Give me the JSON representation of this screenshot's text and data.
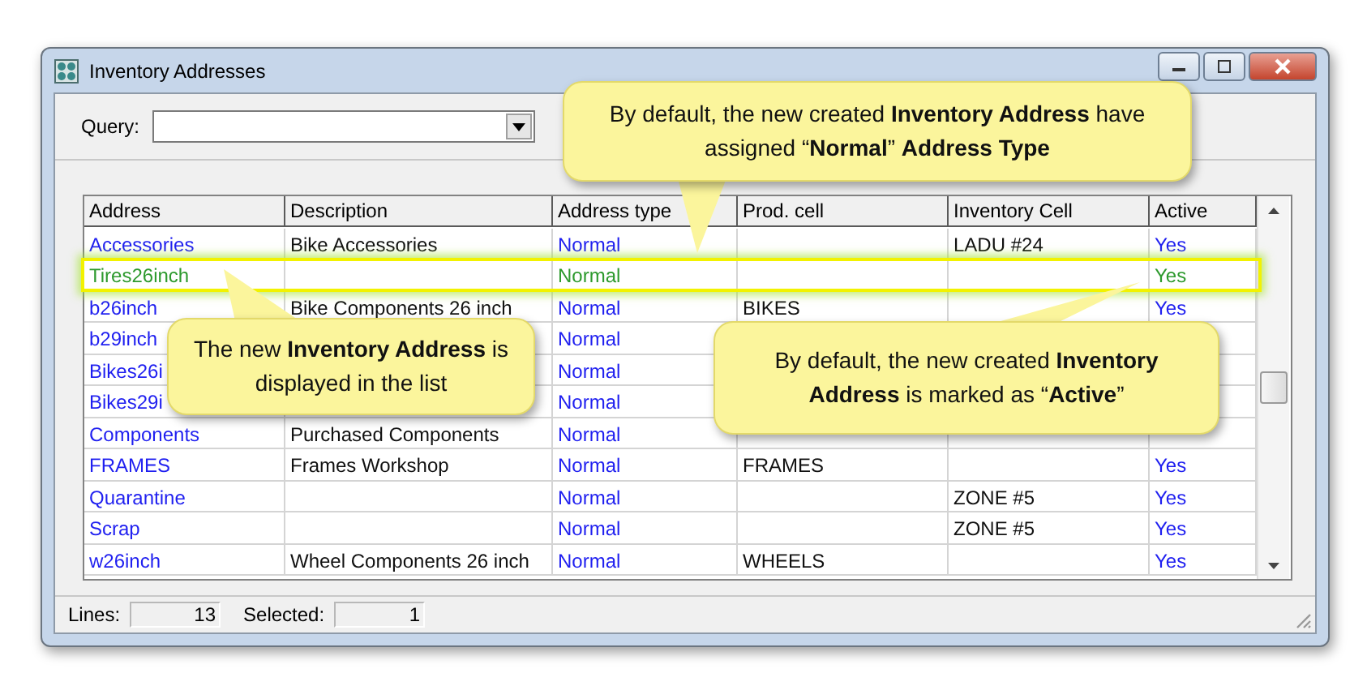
{
  "window": {
    "title": "Inventory Addresses"
  },
  "query": {
    "label": "Query:"
  },
  "table": {
    "columns": [
      "Address",
      "Description",
      "Address type",
      "Prod. cell",
      "Inventory Cell",
      "Active"
    ],
    "rows": [
      {
        "highlighted": false,
        "address": "Accessories",
        "description": "Bike Accessories",
        "address_type": "Normal",
        "inventory_cell": "LADU #24",
        "active": "Yes"
      },
      {
        "highlighted": true,
        "address": "Tires26inch",
        "address_type": "Normal",
        "active": "Yes"
      },
      {
        "highlighted": false,
        "address": "b26inch",
        "description": "Bike Components 26 inch",
        "address_type": "Normal",
        "prod_cell": "BIKES",
        "active": "Yes"
      },
      {
        "highlighted": false,
        "address": "b29inch",
        "address_type": "Normal"
      },
      {
        "highlighted": false,
        "address": "Bikes26i",
        "address_type": "Normal"
      },
      {
        "highlighted": false,
        "address": "Bikes29i",
        "address_type": "Normal"
      },
      {
        "highlighted": false,
        "address": "Components",
        "description": "Purchased Components",
        "address_type": "Normal"
      },
      {
        "highlighted": false,
        "address": "FRAMES",
        "description": "Frames Workshop",
        "address_type": "Normal",
        "prod_cell": "FRAMES",
        "active": "Yes"
      },
      {
        "highlighted": false,
        "address": "Quarantine",
        "address_type": "Normal",
        "inventory_cell": "ZONE #5",
        "active": "Yes"
      },
      {
        "highlighted": false,
        "address": "Scrap",
        "address_type": "Normal",
        "inventory_cell": "ZONE #5",
        "active": "Yes"
      },
      {
        "highlighted": false,
        "address": "w26inch",
        "description": "Wheel Components 26 inch",
        "address_type": "Normal",
        "prod_cell": "WHEELS",
        "active": "Yes"
      }
    ]
  },
  "status_bar": {
    "lines_label": "Lines:",
    "lines": "13",
    "selected_label": "Selected:",
    "selected": "1"
  },
  "callouts": [
    {
      "text": "By default, the new created **Inventory Address** have assigned “**Normal**”  **Address Type**"
    },
    {
      "text": "The new **Inventory Address** is displayed in the list"
    },
    {
      "text": "By default, the new created **Inventory Address** is marked as “**Active**”"
    }
  ]
}
